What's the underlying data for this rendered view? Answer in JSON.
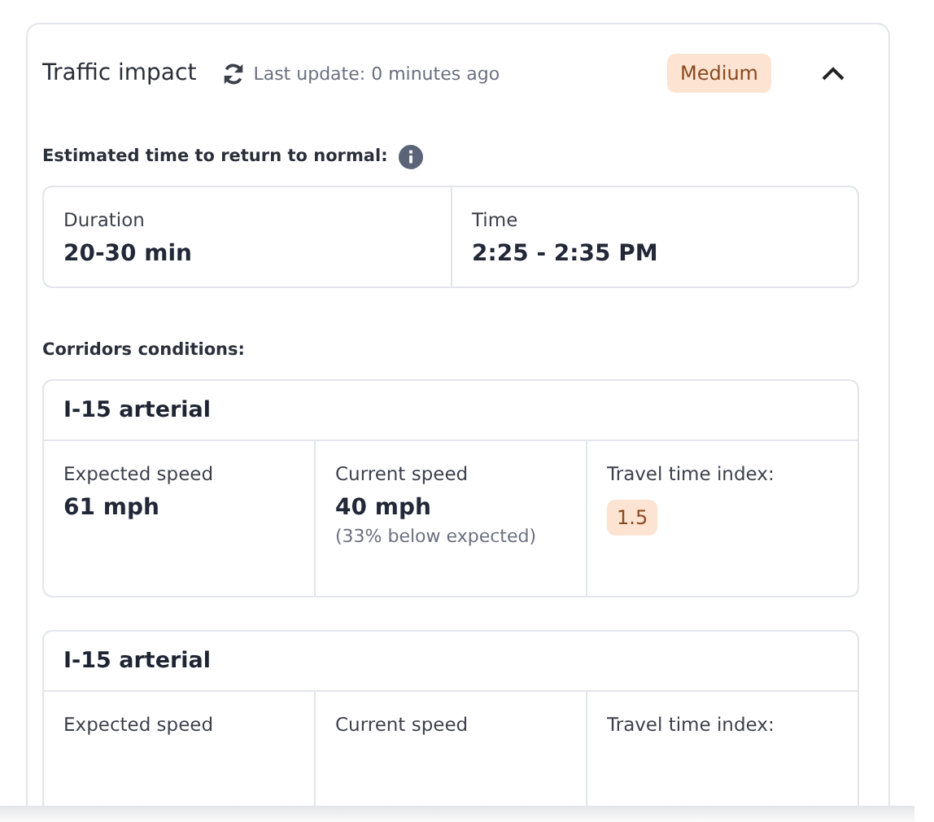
{
  "panel": {
    "title": "Traffic impact",
    "last_update": "Last update: 0 minutes ago",
    "severity": "Medium",
    "expanded": true
  },
  "return_to_normal": {
    "label": "Estimated time to return to normal:",
    "cells": [
      {
        "label": "Duration",
        "value": "20-30 min"
      },
      {
        "label": "Time",
        "value": "2:25 - 2:35 PM"
      }
    ]
  },
  "corridors_label": "Corridors conditions:",
  "corridors": [
    {
      "name": "I-15 arterial",
      "expected": {
        "label": "Expected speed",
        "value": "61 mph"
      },
      "current": {
        "label": "Current speed",
        "value": "40 mph",
        "note": "(33% below expected)"
      },
      "index": {
        "label": "Travel time index:",
        "value": "1.5"
      }
    },
    {
      "name": "I-15 arterial",
      "expected": {
        "label": "Expected speed"
      },
      "current": {
        "label": "Current speed"
      },
      "index": {
        "label": "Travel time index:"
      }
    }
  ]
}
